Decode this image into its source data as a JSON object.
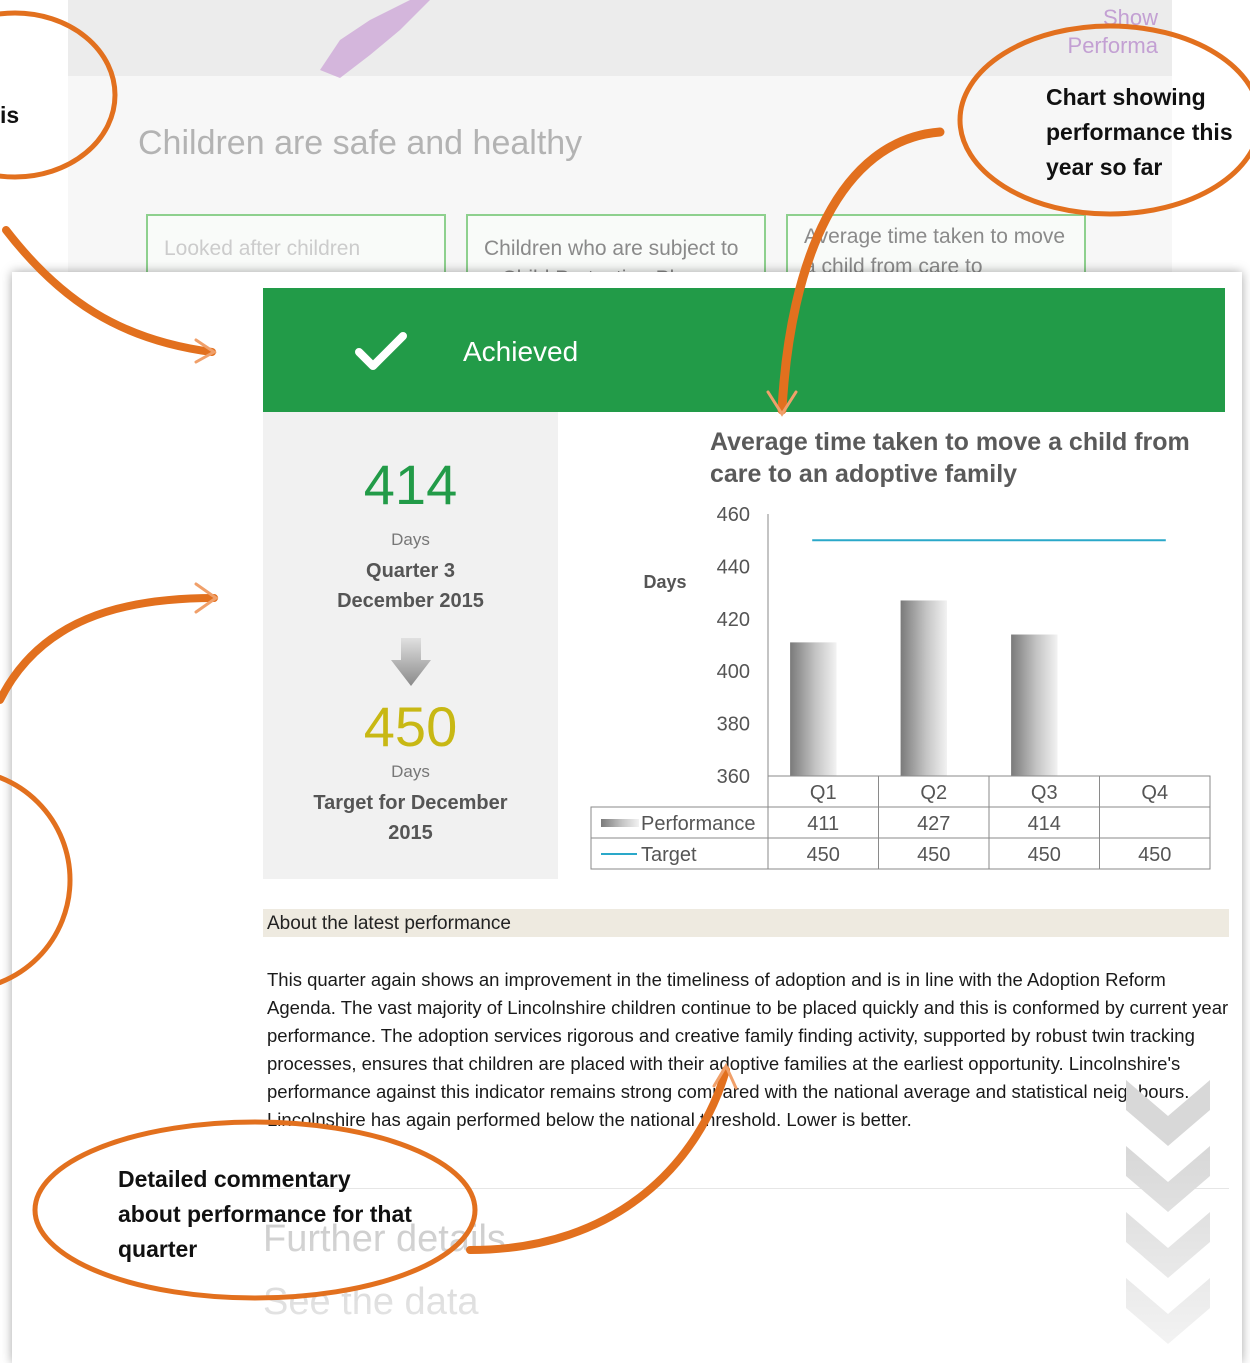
{
  "background_page": {
    "show_link": [
      "Show",
      "Performa"
    ],
    "heading": "Children are safe and healthy",
    "tiles": [
      {
        "label": "Looked after children"
      },
      {
        "label": "Children who are subject to a Child Protection Plan"
      },
      {
        "label": "Average time taken to move a child from care to"
      }
    ]
  },
  "status": {
    "label": "Achieved",
    "icon": "checkmark-icon",
    "color": "#229b48"
  },
  "summary": {
    "actual_value": "414",
    "actual_unit": "Days",
    "actual_period": "Quarter 3 December 2015",
    "arrow_icon": "down-arrow-icon",
    "target_value": "450",
    "target_unit": "Days",
    "target_period": "Target for December 2015",
    "actual_color": "#229b48",
    "target_color": "#c8b814"
  },
  "chart_data": {
    "type": "bar",
    "title": "Average time taken to move a child from care to an adoptive family",
    "ylabel": "Days",
    "xlabel": "",
    "ylim": [
      360,
      460
    ],
    "yticks": [
      360,
      380,
      400,
      420,
      440,
      460
    ],
    "categories": [
      "Q1",
      "Q2",
      "Q3",
      "Q4"
    ],
    "series": [
      {
        "name": "Performance",
        "type": "bar",
        "values": [
          411,
          427,
          414,
          null
        ],
        "labels": [
          "411",
          "427",
          "414",
          ""
        ]
      },
      {
        "name": "Target",
        "type": "line",
        "values": [
          450,
          450,
          450,
          450
        ],
        "labels": [
          "450",
          "450",
          "450",
          "450"
        ],
        "color": "#2aa8c9"
      }
    ]
  },
  "about": {
    "header": "About the latest performance",
    "text": "This quarter again shows an improvement in the timeliness of adoption and is in line with the Adoption Reform Agenda. The vast majority of Lincolnshire children continue to be placed quickly and this is conformed by current year performance. The adoption services rigorous and creative family finding activity, supported by robust twin tracking processes, ensures that children are placed with their adoptive families at the earliest opportunity. Lincolnshire's performance against this indicator remains strong compared with the national average and statistical neighbours. Lincolnshire has again  performed below the national threshold. Lower is better."
  },
  "links": {
    "further_details": "Further details",
    "see_data": "See the data"
  },
  "annotations": [
    {
      "text": "Chart showing performance this year so far"
    },
    {
      "text": "is"
    },
    {
      "text": "Detailed commentary about performance for that quarter"
    }
  ],
  "colors": {
    "annotation_orange": "#e2701e",
    "arrow_orange": "#f0a06a",
    "target_line": "#2aa8c9"
  }
}
